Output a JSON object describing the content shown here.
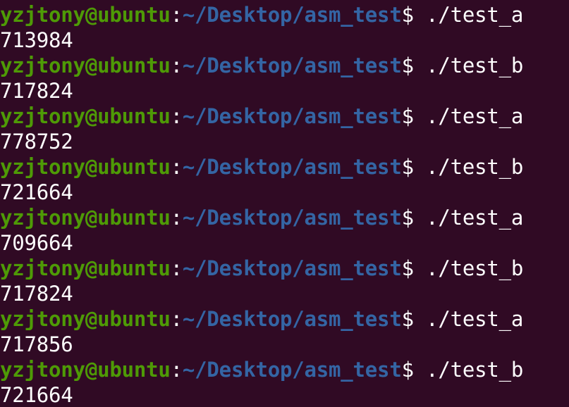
{
  "terminal": {
    "user_host": "yzjtony@ubuntu",
    "separator": ":",
    "path": "~/Desktop/asm_test",
    "dollar": "$ ",
    "colors": {
      "background": "#300a24",
      "user_host": "#4e9a06",
      "path": "#3465a4",
      "text": "#ffffff"
    },
    "entries": [
      {
        "command": "./test_a",
        "output": "713984"
      },
      {
        "command": "./test_b",
        "output": "717824"
      },
      {
        "command": "./test_a",
        "output": "778752"
      },
      {
        "command": "./test_b",
        "output": "721664"
      },
      {
        "command": "./test_a",
        "output": "709664"
      },
      {
        "command": "./test_b",
        "output": "717824"
      },
      {
        "command": "./test_a",
        "output": "717856"
      },
      {
        "command": "./test_b",
        "output": "721664"
      }
    ]
  }
}
